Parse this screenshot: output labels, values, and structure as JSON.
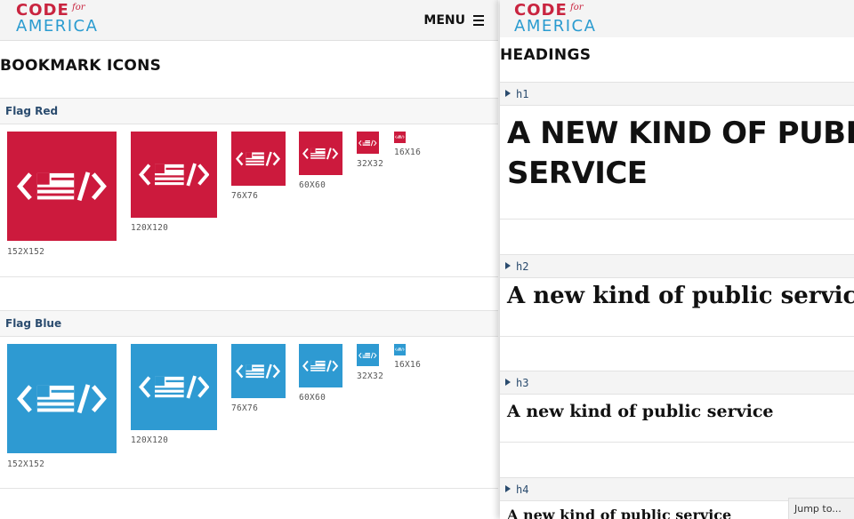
{
  "brand": {
    "code": "CODE",
    "for": "for",
    "america": "AMERICA"
  },
  "header": {
    "menu_label": "MENU"
  },
  "left": {
    "title": "BOOKMARK ICONS",
    "groups": [
      {
        "name": "Flag Red",
        "color": "#cc1a3d",
        "icons": [
          "152X152",
          "120X120",
          "76X76",
          "60X60",
          "32X32",
          "16X16"
        ]
      },
      {
        "name": "Flag Blue",
        "color": "#2e9ad2",
        "icons": [
          "152X152",
          "120X120",
          "76X76",
          "60X60",
          "32X32",
          "16X16"
        ]
      }
    ]
  },
  "right": {
    "title": "HEADINGS",
    "sections": [
      {
        "tag": "h1",
        "sample": "A NEW KIND OF PUBLIC",
        "sample2": "SERVICE"
      },
      {
        "tag": "h2",
        "sample": "A new kind of public service"
      },
      {
        "tag": "h3",
        "sample": "A new kind of public service"
      },
      {
        "tag": "h4",
        "sample": "A new kind of public service"
      }
    ],
    "jump_label": "Jump to..."
  },
  "colors": {
    "red": "#cc1a3d",
    "blue": "#2e9ad2",
    "nav_text": "#2a4b6e"
  }
}
